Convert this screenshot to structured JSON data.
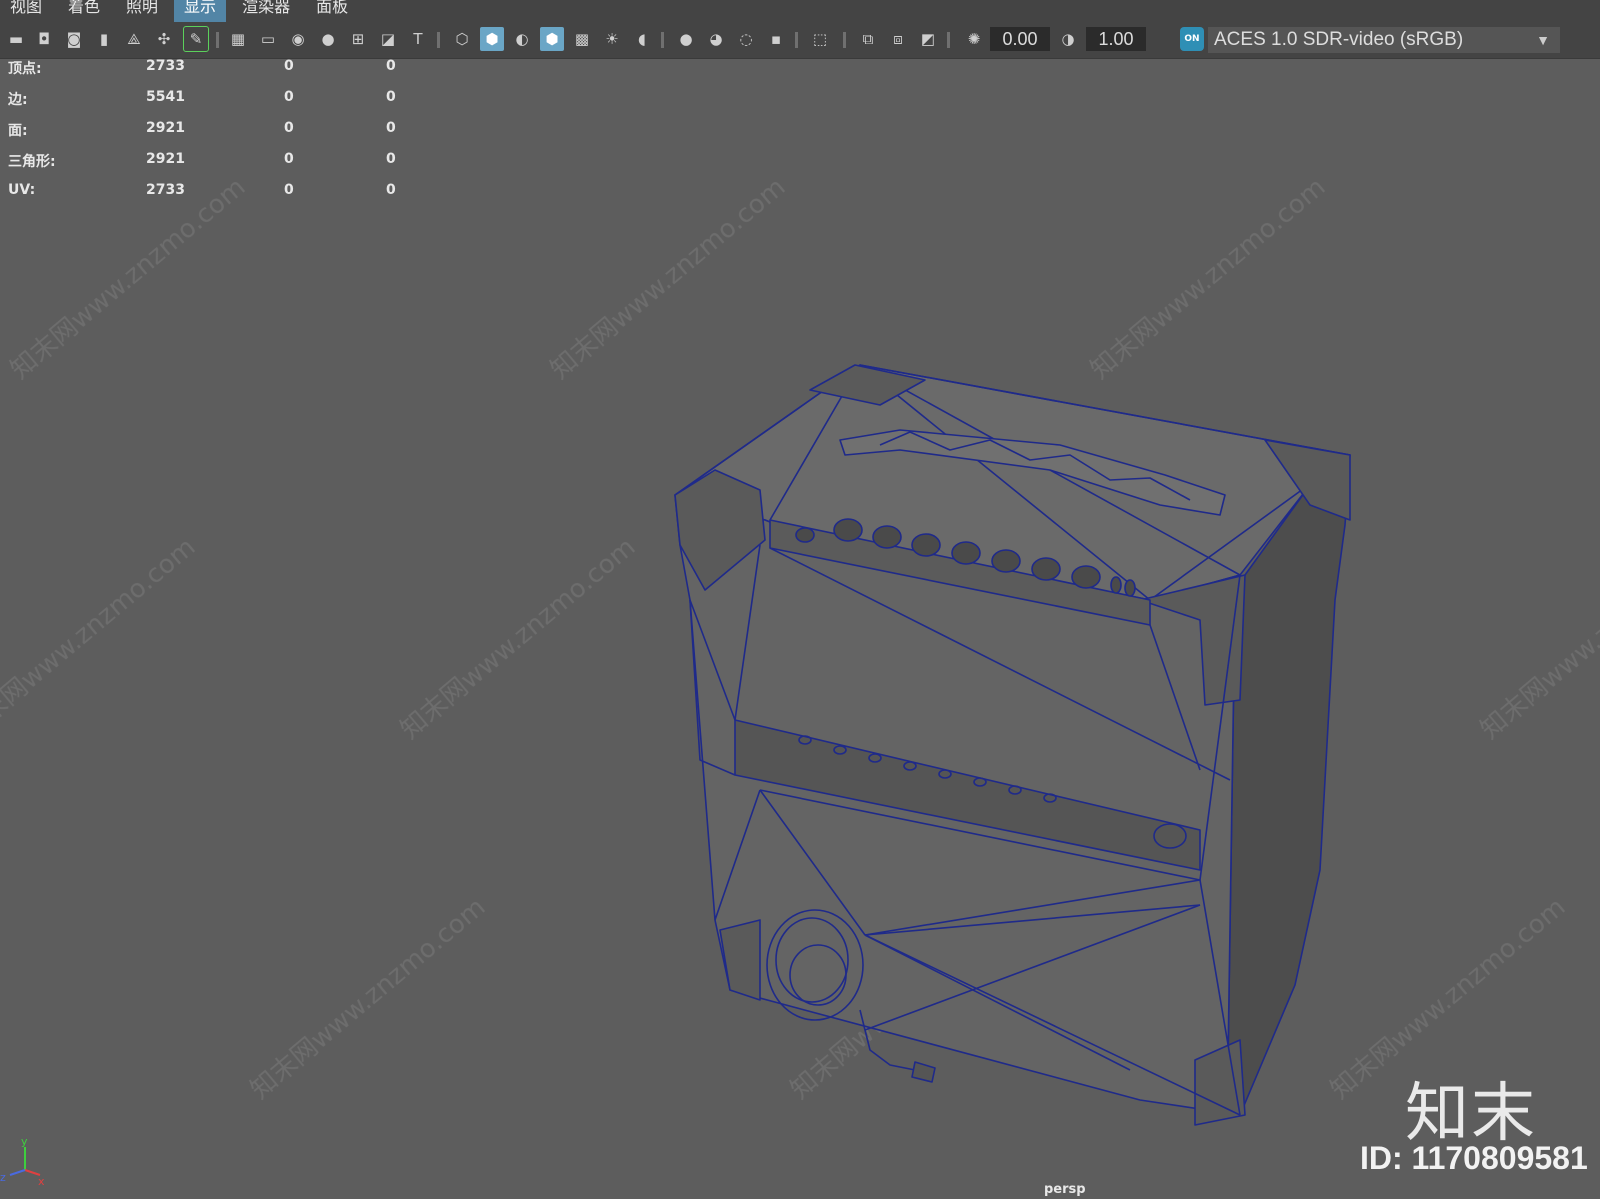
{
  "menu": {
    "items": [
      {
        "label": "视图",
        "active": false
      },
      {
        "label": "着色",
        "active": false
      },
      {
        "label": "照明",
        "active": false
      },
      {
        "label": "显示",
        "active": true
      },
      {
        "label": "渲染器",
        "active": false
      },
      {
        "label": "面板",
        "active": false
      }
    ]
  },
  "toolbar": {
    "exposure_value": "0.00",
    "gamma_value": "1.00",
    "color_space": "ACES 1.0 SDR-video (sRGB)",
    "color_mgmt_badge": "ON"
  },
  "hud": {
    "rows": [
      {
        "label": "顶点:",
        "values": [
          "2733",
          "0",
          "0"
        ]
      },
      {
        "label": "边:",
        "values": [
          "5541",
          "0",
          "0"
        ]
      },
      {
        "label": "面:",
        "values": [
          "2921",
          "0",
          "0"
        ]
      },
      {
        "label": "三角形:",
        "values": [
          "2921",
          "0",
          "0"
        ]
      },
      {
        "label": "UV:",
        "values": [
          "2733",
          "0",
          "0"
        ]
      }
    ]
  },
  "viewport": {
    "camera_label": "persp",
    "watermark_logo": "知末",
    "watermark_id": "ID: 1170809581",
    "watermark_text": "知末网www.znzmo.com",
    "axis": {
      "y": "y",
      "z": "z",
      "x": "x"
    },
    "colors": {
      "background": "#5d5d5d",
      "wire": "#1f2a8a",
      "face": "#6b6b6b"
    }
  }
}
